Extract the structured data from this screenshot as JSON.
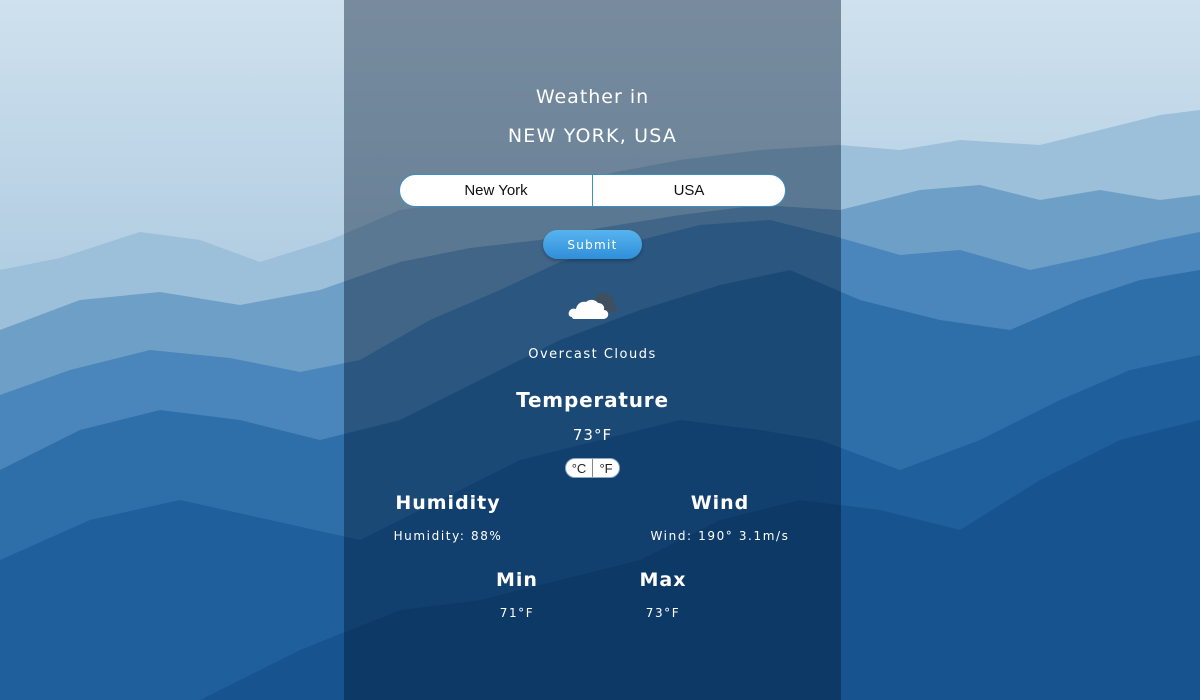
{
  "header": {
    "line1": "Weather in",
    "line2": "NEW YORK, USA"
  },
  "form": {
    "city_value": "New York",
    "country_value": "USA",
    "submit_label": "Submit"
  },
  "condition": {
    "icon": "cloud-icon",
    "description": "Overcast Clouds"
  },
  "temperature": {
    "heading": "Temperature",
    "value": "73°F",
    "unit_c": "°C",
    "unit_f": "°F"
  },
  "humidity": {
    "heading": "Humidity",
    "value": "Humidity: 88%"
  },
  "wind": {
    "heading": "Wind",
    "value": "Wind: 190° 3.1m/s"
  },
  "min": {
    "heading": "Min",
    "value": "71°F"
  },
  "max": {
    "heading": "Max",
    "value": "73°F"
  },
  "colors": {
    "panel": "#0c2c4e",
    "accent": "#3a8fc4",
    "button": "#3b9ce0"
  }
}
